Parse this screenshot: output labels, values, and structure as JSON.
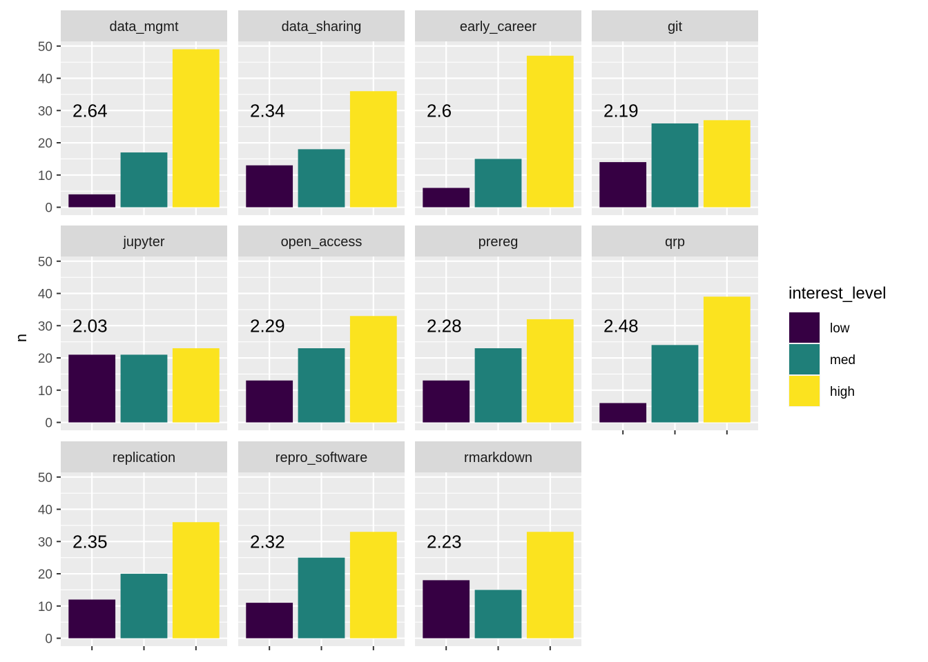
{
  "chart_data": {
    "type": "bar",
    "layout": "facet_wrap",
    "ylabel": "n",
    "xlabel": "",
    "ylim": [
      0,
      50
    ],
    "yticks": [
      0,
      10,
      20,
      30,
      40,
      50
    ],
    "categories": [
      "low",
      "med",
      "high"
    ],
    "legend": {
      "title": "interest_level",
      "position": "right",
      "entries": [
        {
          "label": "low",
          "color": "#360043"
        },
        {
          "label": "med",
          "color": "#1F7F79"
        },
        {
          "label": "high",
          "color": "#FBE31F"
        }
      ]
    },
    "facets": [
      {
        "name": "data_mgmt",
        "annotation": "2.64",
        "values": [
          4,
          17,
          49
        ]
      },
      {
        "name": "data_sharing",
        "annotation": "2.34",
        "values": [
          13,
          18,
          36
        ]
      },
      {
        "name": "early_career",
        "annotation": "2.6",
        "values": [
          6,
          15,
          47
        ]
      },
      {
        "name": "git",
        "annotation": "2.19",
        "values": [
          14,
          26,
          27
        ]
      },
      {
        "name": "jupyter",
        "annotation": "2.03",
        "values": [
          21,
          21,
          23
        ]
      },
      {
        "name": "open_access",
        "annotation": "2.29",
        "values": [
          13,
          23,
          33
        ]
      },
      {
        "name": "prereg",
        "annotation": "2.28",
        "values": [
          13,
          23,
          32
        ]
      },
      {
        "name": "qrp",
        "annotation": "2.48",
        "values": [
          6,
          24,
          39
        ]
      },
      {
        "name": "replication",
        "annotation": "2.35",
        "values": [
          12,
          20,
          36
        ]
      },
      {
        "name": "repro_software",
        "annotation": "2.32",
        "values": [
          11,
          25,
          33
        ]
      },
      {
        "name": "rmarkdown",
        "annotation": "2.23",
        "values": [
          18,
          15,
          33
        ]
      }
    ],
    "annotation_y": 30
  }
}
